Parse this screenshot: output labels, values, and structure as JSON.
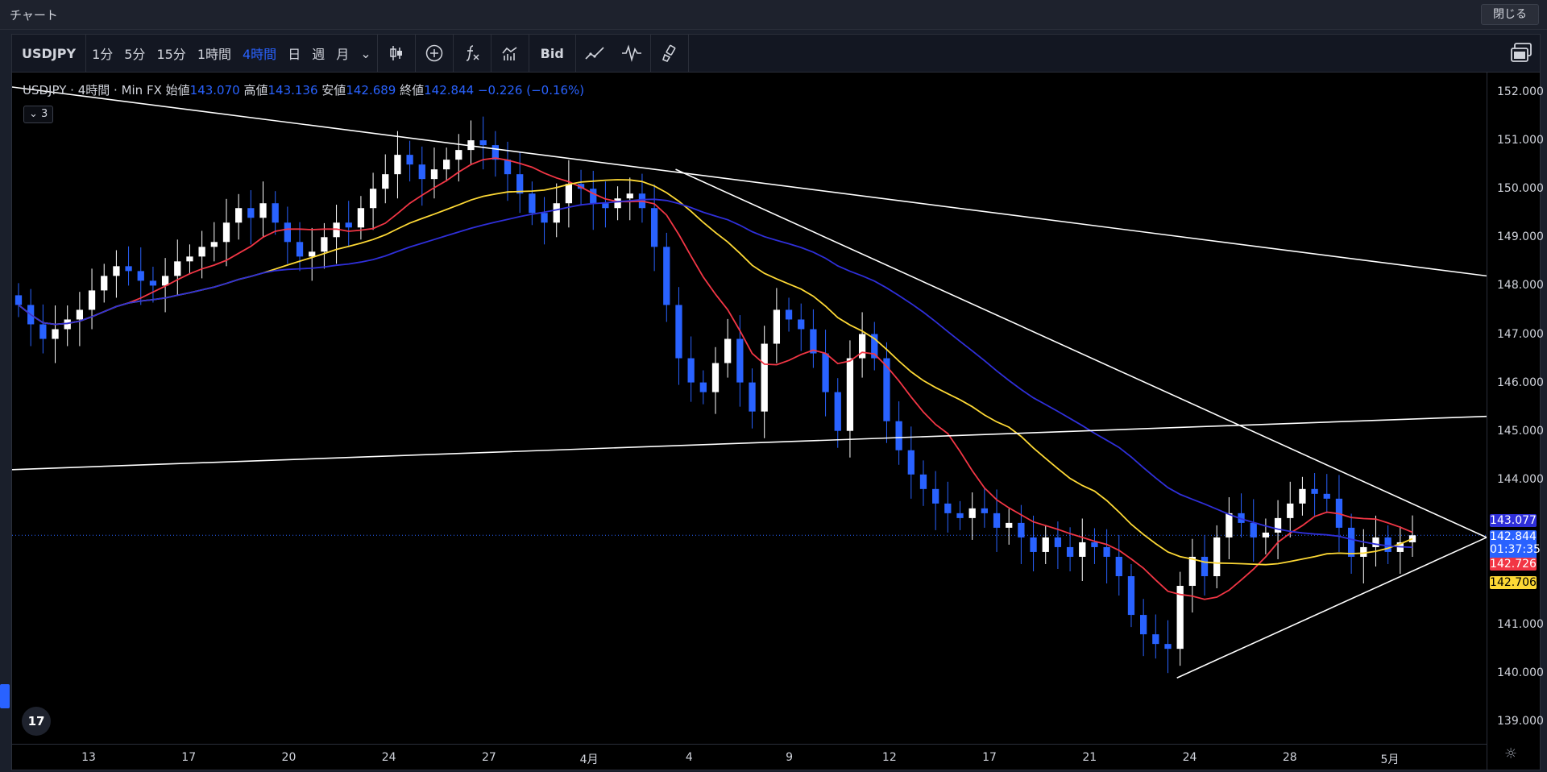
{
  "window": {
    "title": "チャート",
    "close_label": "閉じる"
  },
  "toolbar": {
    "symbol": "USDJPY",
    "intervals": [
      "1分",
      "5分",
      "15分",
      "1時間",
      "4時間",
      "日",
      "週",
      "月"
    ],
    "active_interval": "4時間",
    "dropdown_glyph": "⌄",
    "bid_label": "Bid",
    "icons": [
      "candles-icon",
      "add-circle-icon",
      "indicator-fx-icon",
      "indicators-icon",
      "bid-label",
      "line-tool-icon",
      "wave-icon",
      "brush-icon",
      "layout-icon"
    ]
  },
  "legend": {
    "symbol": "USDJPY",
    "interval": "4時間",
    "source": "Min FX",
    "open_label": "始値",
    "open": "143.070",
    "high_label": "高値",
    "high": "143.136",
    "low_label": "安値",
    "low": "142.689",
    "close_label": "終値",
    "close": "142.844",
    "change": "−0.226 (−0.16%)",
    "collapse_label": "3"
  },
  "price_badges": {
    "blue_ma": {
      "value": "143.077",
      "color": "#2f2fd9"
    },
    "last": {
      "value": "142.844",
      "countdown": "01:37:35",
      "color": "#2962ff"
    },
    "red_ma": {
      "value": "142.726",
      "color": "#f23645"
    },
    "yellow_ma": {
      "value": "142.706",
      "color": "#fdd835"
    }
  },
  "chart_data": {
    "type": "candlestick",
    "y_ticks": [
      "152.000",
      "151.000",
      "150.000",
      "149.000",
      "148.000",
      "147.000",
      "146.000",
      "145.000",
      "144.000",
      "141.000",
      "140.000",
      "139.000"
    ],
    "y_range": [
      139.0,
      152.0
    ],
    "x_ticks": [
      "13",
      "17",
      "20",
      "24",
      "27",
      "4月",
      "4",
      "9",
      "12",
      "17",
      "21",
      "24",
      "28",
      "5月"
    ],
    "closes": [
      147.6,
      147.2,
      146.9,
      147.1,
      147.3,
      147.5,
      147.9,
      148.2,
      148.4,
      148.3,
      148.1,
      148.0,
      148.2,
      148.5,
      148.6,
      148.8,
      148.9,
      149.3,
      149.6,
      149.4,
      149.7,
      149.3,
      148.9,
      148.6,
      148.7,
      149.0,
      149.3,
      149.2,
      149.6,
      150.0,
      150.3,
      150.7,
      150.5,
      150.2,
      150.4,
      150.6,
      150.8,
      151.0,
      150.9,
      150.6,
      150.3,
      149.9,
      149.5,
      149.3,
      149.7,
      150.1,
      150.0,
      149.7,
      149.6,
      149.8,
      149.9,
      149.6,
      148.8,
      147.6,
      146.5,
      146.0,
      145.8,
      146.4,
      146.9,
      146.0,
      145.4,
      146.8,
      147.5,
      147.3,
      147.1,
      146.6,
      145.8,
      145.0,
      146.5,
      147.0,
      146.5,
      145.2,
      144.6,
      144.1,
      143.8,
      143.5,
      143.3,
      143.2,
      143.4,
      143.3,
      143.0,
      143.1,
      142.8,
      142.5,
      142.8,
      142.6,
      142.4,
      142.7,
      142.6,
      142.4,
      142.0,
      141.2,
      140.8,
      140.6,
      140.5,
      141.8,
      142.4,
      142.0,
      142.8,
      143.3,
      143.1,
      142.8,
      142.9,
      143.2,
      143.5,
      143.8,
      143.7,
      143.6,
      143.0,
      142.4,
      142.6,
      142.8,
      142.5,
      142.7,
      142.844
    ],
    "series": [
      {
        "name": "",
        "color": "#f23645",
        "period": 9
      },
      {
        "name": "",
        "color": "#fdd835",
        "period": 21
      },
      {
        "name": "",
        "color": "#2f2fd9",
        "period": 75
      }
    ],
    "trendlines": [
      {
        "from": [
          0,
          152.1
        ],
        "to": [
          1,
          148.2
        ]
      },
      {
        "from": [
          0.45,
          150.4
        ],
        "to": [
          1,
          142.8
        ]
      },
      {
        "from": [
          0,
          144.2
        ],
        "to": [
          1,
          145.3
        ]
      },
      {
        "from": [
          0.79,
          139.9
        ],
        "to": [
          1,
          142.8
        ]
      }
    ],
    "grid": false,
    "last_price": 142.844
  }
}
